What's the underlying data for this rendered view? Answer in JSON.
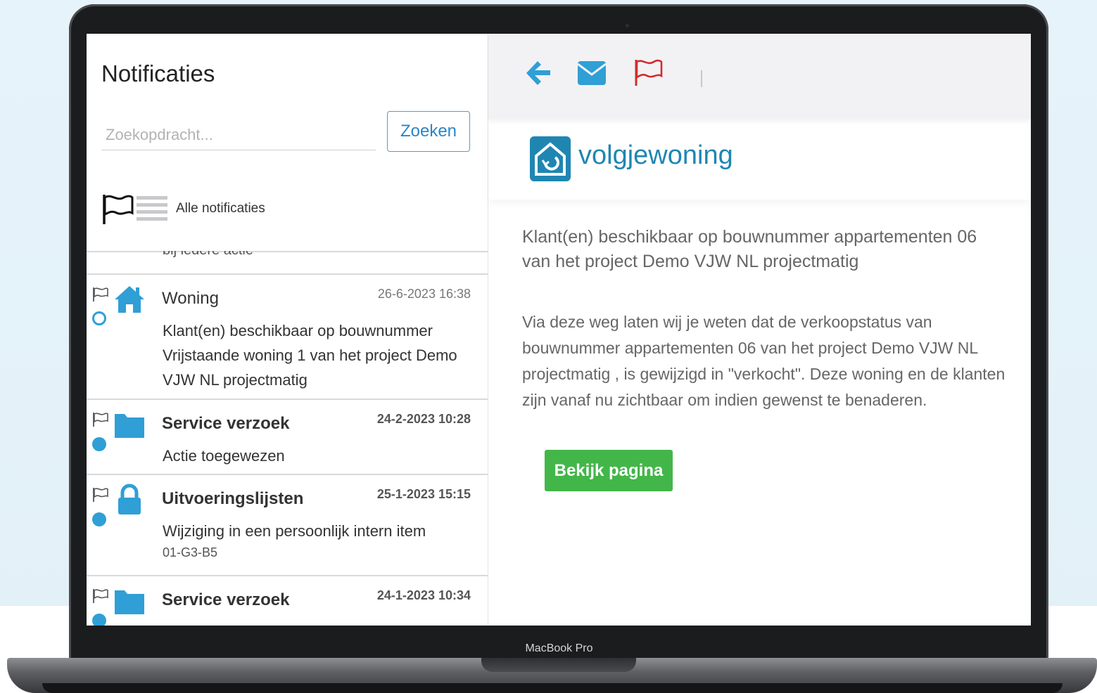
{
  "device": {
    "label": "MacBook Pro"
  },
  "left_panel": {
    "title": "Notificaties",
    "search": {
      "placeholder": "Zoekopdracht...",
      "value": "",
      "button_label": "Zoeken"
    },
    "filter": {
      "label": "Alle notificaties"
    },
    "cut_off_text": "bij iedere actie",
    "items": [
      {
        "icon": "house-icon",
        "title": "Woning",
        "date": "26-6-2023 16:38",
        "status": "read",
        "body": "Klant(en) beschikbaar op bouwnummer Vrijstaande woning 1 van het project Demo VJW NL projectmatig",
        "sub": ""
      },
      {
        "icon": "folder-icon",
        "title": "Service verzoek",
        "date": "24-2-2023 10:28",
        "status": "unread",
        "body": "Actie toegewezen",
        "sub": ""
      },
      {
        "icon": "lock-icon",
        "title": "Uitvoeringslijsten",
        "date": "25-1-2023 15:15",
        "status": "unread",
        "body": "Wijziging in een persoonlijk intern item",
        "sub": "01-G3-B5"
      },
      {
        "icon": "folder-icon",
        "title": "Service verzoek",
        "date": "24-1-2023 10:34",
        "status": "unread",
        "body": "",
        "sub": ""
      }
    ]
  },
  "right_panel": {
    "toolbar": {
      "back_icon": "arrow-left-icon",
      "mail_icon": "envelope-icon",
      "flag_icon": "flag-icon"
    },
    "brand": {
      "name": "volgjewoning"
    },
    "message": {
      "title": "Klant(en) beschikbaar op bouwnummer appartementen 06 van het project Demo VJW NL projectmatig",
      "body": "Via deze weg laten wij je weten dat de verkoopstatus van bouwnummer appartementen 06 van het project Demo VJW NL projectmatig , is gewijzigd in \"verkocht\". Deze woning en de klanten zijn vanaf nu zichtbaar om indien gewenst te benaderen.",
      "button_label": "Bekijk pagina"
    }
  },
  "colors": {
    "accent_blue": "#2f9fd6",
    "brand_blue": "#1f86b2",
    "flag_red": "#d62b2b",
    "button_green": "#43b649"
  }
}
